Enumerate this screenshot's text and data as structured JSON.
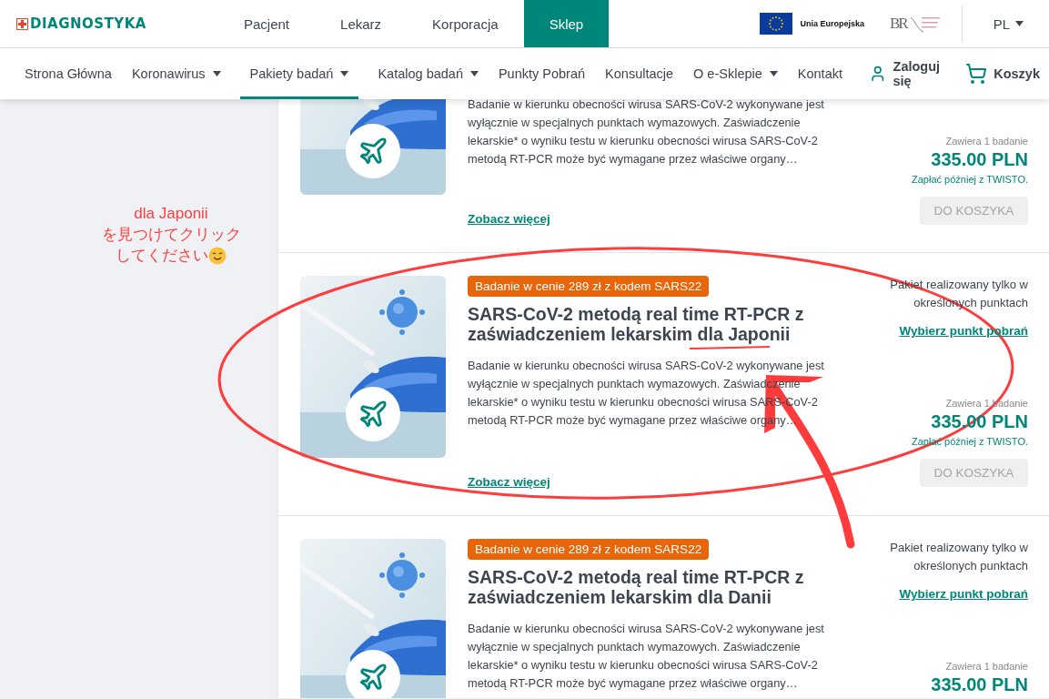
{
  "header": {
    "logo": "DIAGNOSTYKA",
    "sections": [
      {
        "label": "Pacjent",
        "selected": false
      },
      {
        "label": "Lekarz",
        "selected": false
      },
      {
        "label": "Korporacja",
        "selected": false
      },
      {
        "label": "Sklep",
        "selected": true
      }
    ],
    "eu_label": "Unia Europejska",
    "partner_mark": "BR",
    "language": "PL"
  },
  "nav": {
    "items": [
      {
        "label": "Strona Główna",
        "has_menu": false,
        "selected": false
      },
      {
        "label": "Koronawirus",
        "has_menu": true,
        "selected": false
      },
      {
        "label": "Pakiety badań",
        "has_menu": true,
        "selected": true
      },
      {
        "label": "Katalog badań",
        "has_menu": true,
        "selected": false
      },
      {
        "label": "Punkty Pobrań",
        "has_menu": false,
        "selected": false
      },
      {
        "label": "Konsultacje",
        "has_menu": false,
        "selected": false
      },
      {
        "label": "O e-Sklepie",
        "has_menu": true,
        "selected": false
      },
      {
        "label": "Kontakt",
        "has_menu": false,
        "selected": false
      }
    ],
    "login": "Zaloguj się",
    "cart": "Koszyk"
  },
  "annotation": {
    "line1": "dla Japonii",
    "line2": "を見つけてクリック",
    "line3": "してください"
  },
  "products": [
    {
      "description": "Badanie w kierunku obecności wirusa SARS-CoV-2 wykonywane jest wyłącznie w specjalnych punktach wymazowych. Zaświadczenie lekarskie* o wyniku testu w kierunku obecności wirusa SARS-CoV-2 metodą RT-PCR może być wymagane przez właściwe organy…",
      "more": "Zobacz więcej",
      "contains": "Zawiera 1 badanie",
      "price": "335.00 PLN",
      "pay_later": "Zapłać później z TWISTO.",
      "button": {
        "label": "DO KOSZYKA",
        "disabled": true
      }
    },
    {
      "badge": "Badanie w cenie 289 zł z kodem SARS22",
      "title": "SARS-CoV-2 metodą real time RT-PCR z zaświadczeniem lekarskim dla Japonii",
      "description": "Badanie w kierunku obecności wirusa SARS-CoV-2 wykonywane jest wyłącznie w specjalnych punktach wymazowych. Zaświadczenie lekarskie* o wyniku testu w kierunku obecności wirusa SARS-CoV-2 metodą RT-PCR może być wymagane przez właściwe organy…",
      "more": "Zobacz więcej",
      "note": "Pakiet realizowany tylko w określonych punktach",
      "pick": "Wybierz punkt pobrań",
      "contains": "Zawiera 1 badanie",
      "price": "335.00 PLN",
      "pay_later": "Zapłać później z TWISTO.",
      "button": {
        "label": "DO KOSZYKA",
        "disabled": true
      }
    },
    {
      "badge": "Badanie w cenie 289 zł z kodem SARS22",
      "title": "SARS-CoV-2 metodą real time RT-PCR z zaświadczeniem lekarskim dla Danii",
      "description": "Badanie w kierunku obecności wirusa SARS-CoV-2 wykonywane jest wyłącznie w specjalnych punktach wymazowych. Zaświadczenie lekarskie* o wyniku testu w kierunku obecności wirusa SARS-CoV-2 metodą RT-PCR może być wymagane przez właściwe organy…",
      "note": "Pakiet realizowany tylko w określonych punktach",
      "pick": "Wybierz punkt pobrań",
      "contains": "Zawiera 1 badanie",
      "price": "335.00 PLN"
    }
  ]
}
